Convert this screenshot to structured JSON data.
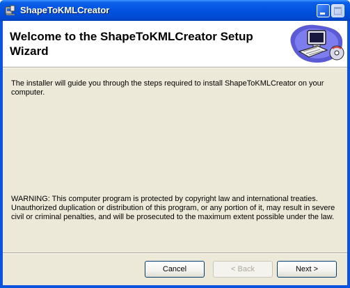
{
  "window": {
    "title": "ShapeToKMLCreator",
    "icons": {
      "app": "installer-icon",
      "minimize": "minimize-icon",
      "maximize": "maximize-icon"
    }
  },
  "banner": {
    "title": "Welcome to the ShapeToKMLCreator Setup Wizard",
    "art": "computer-setup-icon"
  },
  "body": {
    "intro": "The installer will guide you through the steps required to install ShapeToKMLCreator on your computer.",
    "warning": "WARNING: This computer program is protected by copyright law and international treaties. Unauthorized duplication or distribution of this program, or any portion of it, may result in severe civil or criminal penalties, and will be prosecuted to the maximum extent possible under the law."
  },
  "buttons": {
    "cancel": "Cancel",
    "back": "< Back",
    "next": "Next >"
  },
  "colors": {
    "titlebar": "#0353e0",
    "client": "#ece9d8",
    "banner": "#ffffff"
  }
}
